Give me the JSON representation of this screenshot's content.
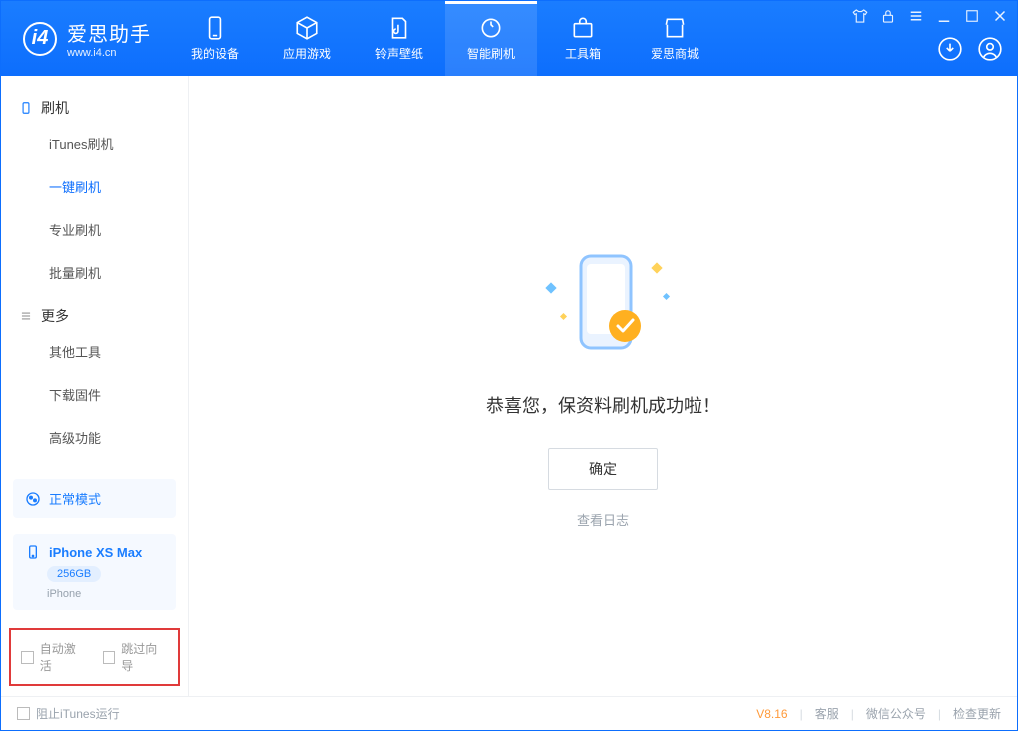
{
  "app": {
    "title": "爱思助手",
    "subtitle": "www.i4.cn"
  },
  "nav": {
    "items": [
      {
        "label": "我的设备"
      },
      {
        "label": "应用游戏"
      },
      {
        "label": "铃声壁纸"
      },
      {
        "label": "智能刷机"
      },
      {
        "label": "工具箱"
      },
      {
        "label": "爱思商城"
      }
    ]
  },
  "sidebar": {
    "group1": {
      "label": "刷机"
    },
    "items1": [
      {
        "label": "iTunes刷机"
      },
      {
        "label": "一键刷机"
      },
      {
        "label": "专业刷机"
      },
      {
        "label": "批量刷机"
      }
    ],
    "group2": {
      "label": "更多"
    },
    "items2": [
      {
        "label": "其他工具"
      },
      {
        "label": "下载固件"
      },
      {
        "label": "高级功能"
      }
    ],
    "mode": "正常模式",
    "device": {
      "name": "iPhone XS Max",
      "capacity": "256GB",
      "type": "iPhone"
    },
    "cbAutoActivate": "自动激活",
    "cbSkipWizard": "跳过向导"
  },
  "main": {
    "successText": "恭喜您，保资料刷机成功啦！",
    "okButton": "确定",
    "viewLog": "查看日志"
  },
  "footer": {
    "blockItunes": "阻止iTunes运行",
    "version": "V8.16",
    "links": {
      "support": "客服",
      "wechat": "微信公众号",
      "update": "检查更新"
    }
  }
}
